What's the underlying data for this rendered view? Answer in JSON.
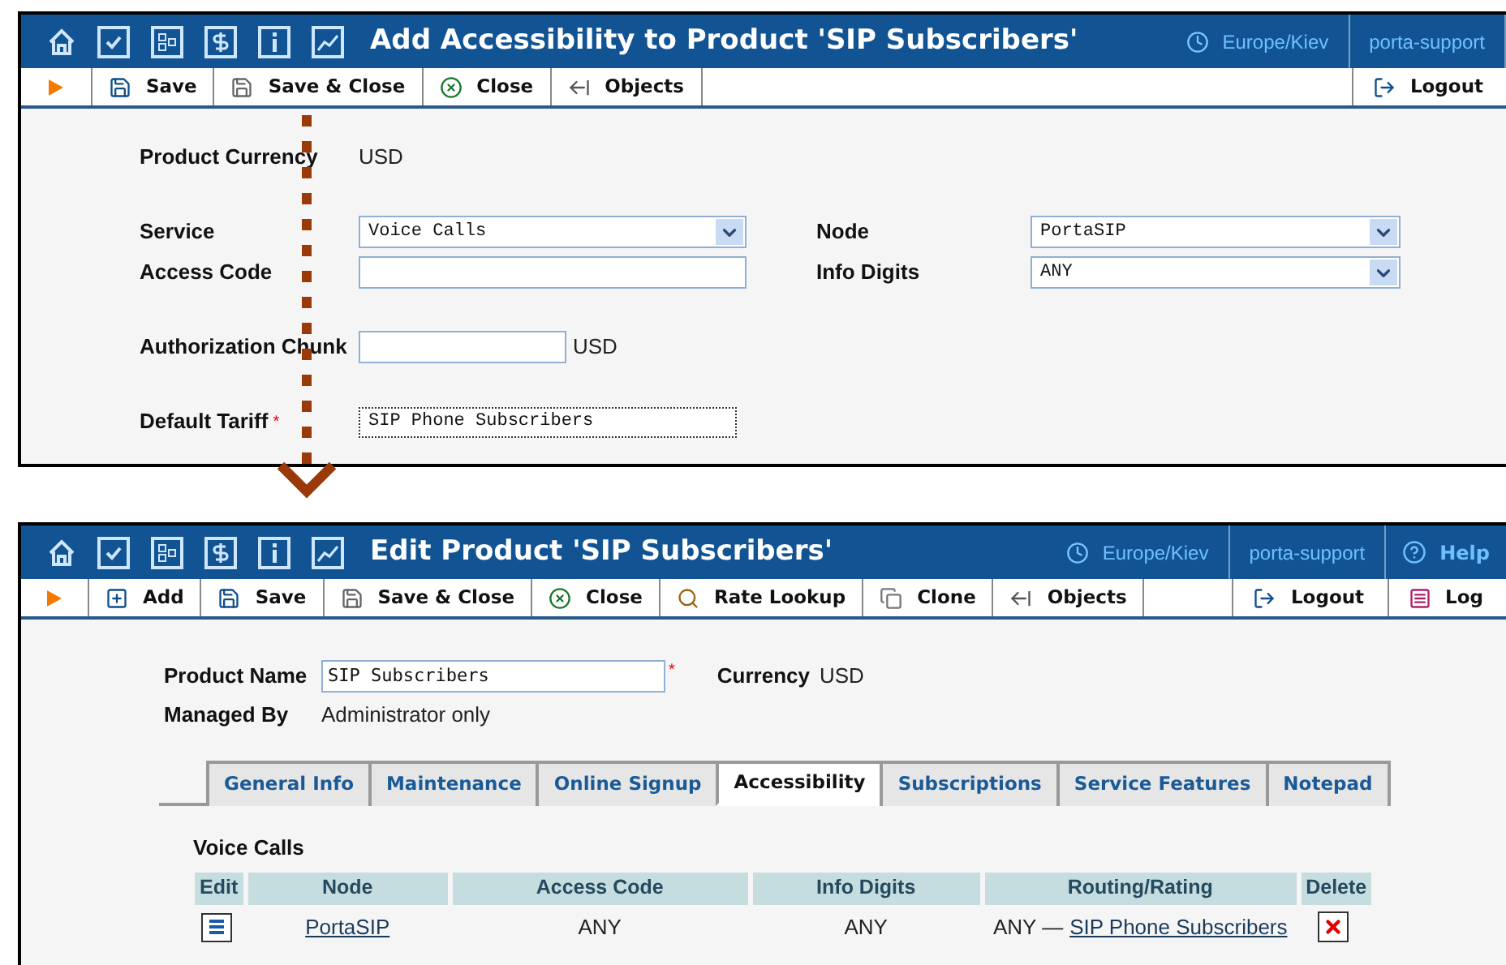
{
  "add_screen": {
    "header": {
      "title": "Add Accessibility to Product 'SIP Subscribers'",
      "timezone": "Europe/Kiev",
      "user": "porta-support"
    },
    "toolbar": [
      {
        "kind": "save",
        "label": "Save"
      },
      {
        "kind": "save_close",
        "label": "Save & Close"
      },
      {
        "kind": "close",
        "label": "Close"
      },
      {
        "kind": "objects",
        "label": "Objects"
      }
    ],
    "toolbar_right": [
      {
        "kind": "logout",
        "label": "Logout"
      }
    ],
    "currency": {
      "label": "Product Currency",
      "value": "USD"
    },
    "rows": [
      [
        {
          "label": "Service",
          "kind": "select",
          "value": "Voice Calls"
        },
        {
          "label": "Node",
          "kind": "select",
          "value": "PortaSIP"
        }
      ],
      [
        {
          "label": "Access Code",
          "kind": "input"
        },
        {
          "label": "Info Digits",
          "kind": "select",
          "value": "ANY"
        }
      ],
      [
        {
          "label": "Authorization Chunk",
          "kind": "input",
          "suffix": "USD"
        }
      ],
      [
        {
          "label": "Default Tariff",
          "kind": "focused_input",
          "value": "SIP Phone Subscribers",
          "required_mark": "*"
        }
      ]
    ]
  },
  "edit_screen": {
    "header": {
      "title": "Edit Product 'SIP Subscribers'",
      "timezone": "Europe/Kiev",
      "user": "porta-support",
      "help": "Help"
    },
    "toolbar": [
      {
        "kind": "add",
        "label": "Add"
      },
      {
        "kind": "save",
        "label": "Save"
      },
      {
        "kind": "save_close",
        "label": "Save & Close"
      },
      {
        "kind": "close",
        "label": "Close"
      },
      {
        "kind": "rate_lookup",
        "label": "Rate Lookup"
      },
      {
        "kind": "clone",
        "label": "Clone"
      },
      {
        "kind": "objects",
        "label": "Objects"
      }
    ],
    "toolbar_right": [
      {
        "kind": "logout",
        "label": "Logout"
      },
      {
        "kind": "log",
        "label": "Log"
      }
    ],
    "product_name": {
      "label": "Product Name",
      "value": "SIP Subscribers",
      "required_mark": "*"
    },
    "currency": {
      "label": "Currency",
      "value": "USD"
    },
    "managed_by": {
      "label": "Managed By",
      "value": "Administrator only"
    },
    "tabs": [
      {
        "label": "General Info",
        "selected": false
      },
      {
        "label": "Maintenance",
        "selected": false
      },
      {
        "label": "Online Signup",
        "selected": false
      },
      {
        "label": "Accessibility",
        "selected": true
      },
      {
        "label": "Subscriptions",
        "selected": false
      },
      {
        "label": "Service Features",
        "selected": false
      },
      {
        "label": "Notepad",
        "selected": false
      }
    ],
    "section_title": "Voice Calls",
    "table": {
      "columns": [
        "Edit",
        "Node",
        "Access Code",
        "Info Digits",
        "Routing/Rating",
        "Delete"
      ],
      "rows": [
        {
          "node": "PortaSIP",
          "access_code": "ANY",
          "info_digits": "ANY",
          "routing_prefix": "ANY —",
          "routing_link": "SIP Phone Subscribers"
        }
      ]
    }
  }
}
